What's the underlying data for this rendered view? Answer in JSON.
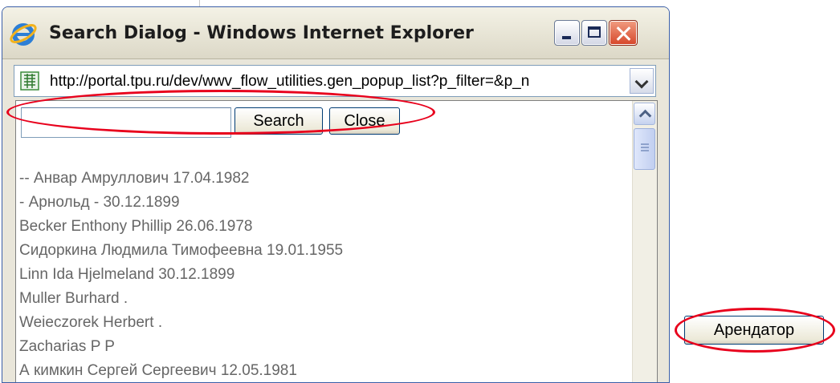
{
  "window": {
    "title": "Search Dialog - Windows Internet Explorer",
    "address": "http://portal.tpu.ru/dev/wwv_flow_utilities.gen_popup_list?p_filter=&p_n"
  },
  "search": {
    "value": "",
    "search_label": "Search",
    "close_label": "Close"
  },
  "list_items": [
    "-- Анвар Амруллович 17.04.1982",
    "- Арнольд - 30.12.1899",
    "Becker Enthony Phillip 26.06.1978",
    "Сидоркина Людмила Тимофеевна 19.01.1955",
    "Linn Ida Hjelmeland 30.12.1899",
    "Muller Burhard .",
    "Weieczorek Herbert .",
    "Zacharias P P",
    "А кимкин Сергей Сергеевич 12.05.1981"
  ],
  "page_button": {
    "label": "Арендатор"
  },
  "colors": {
    "annotation": "#e8001c",
    "list_text": "#666666",
    "window_frame": "#3a5ea8"
  },
  "icons": {
    "title": "ie-logo-icon",
    "address": "page-icon",
    "minimize": "minimize-icon",
    "maximize": "maximize-icon",
    "close": "close-icon"
  }
}
